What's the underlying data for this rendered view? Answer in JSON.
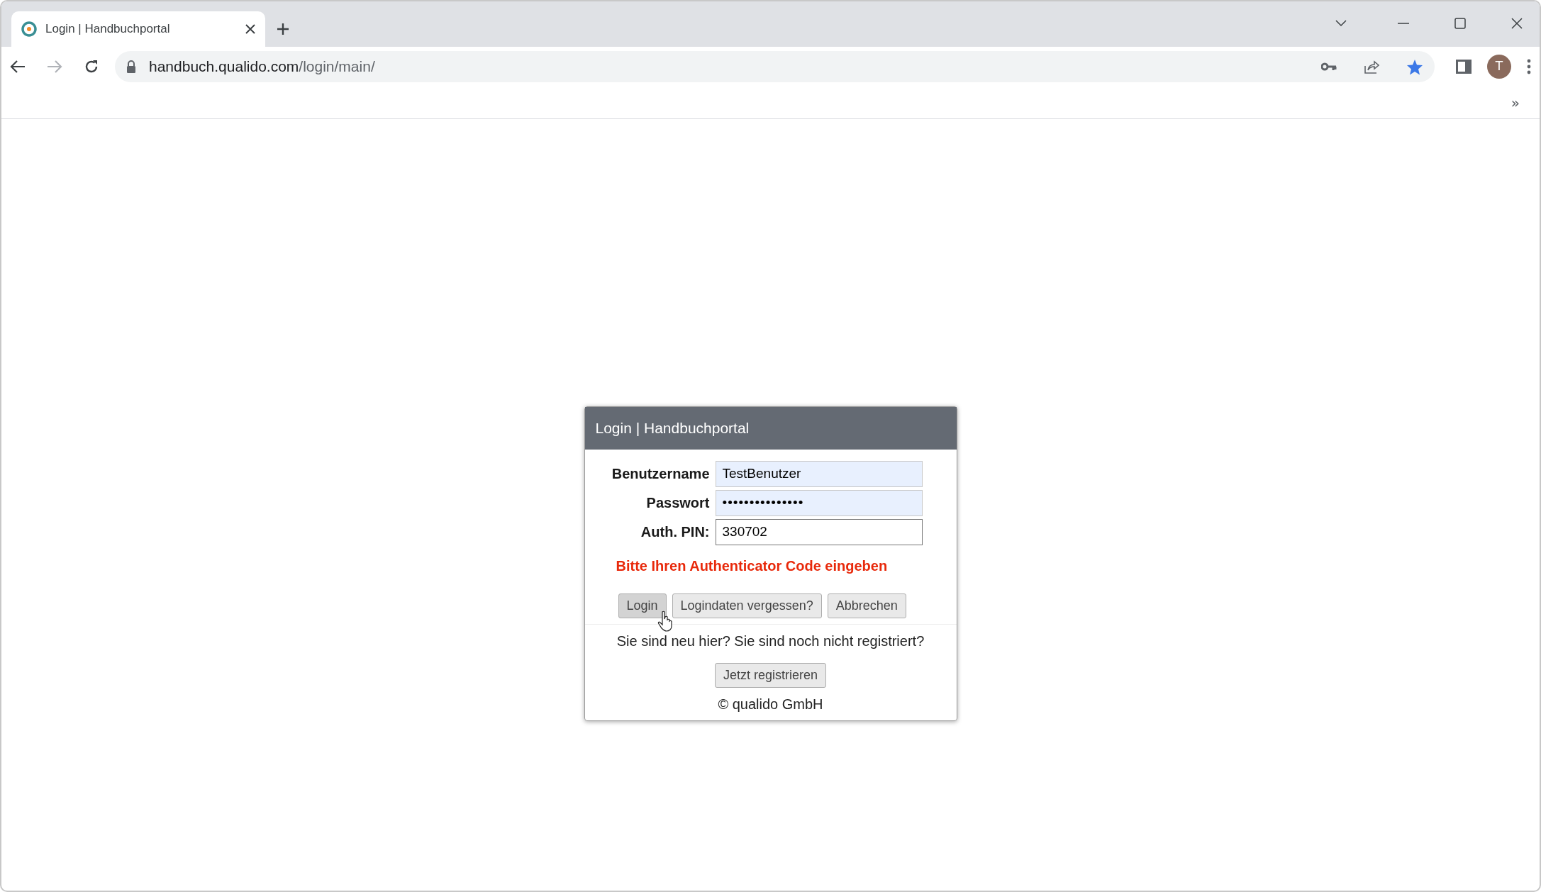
{
  "browser": {
    "tab": {
      "title": "Login | Handbuchportal",
      "selected": true
    },
    "address": {
      "host": "handbuch.qualido.com",
      "path": "/login/main/"
    },
    "profile_initial": "T",
    "bookmarked": true,
    "bookmarks_overflow": "»"
  },
  "dialog": {
    "title": "Login | Handbuchportal",
    "fields": [
      {
        "label": "Benutzername",
        "value": "TestBenutzer",
        "kind": "text",
        "autofilled": true
      },
      {
        "label": "Passwort",
        "value": "•••••••••••••••",
        "kind": "password",
        "autofilled": true
      },
      {
        "label": "Auth. PIN:",
        "value": "330702",
        "kind": "text",
        "autofilled": false
      }
    ],
    "error": "Bitte Ihren Authenticator Code eingeben",
    "buttons": [
      {
        "label": "Login",
        "hovered": true
      },
      {
        "label": "Logindaten vergessen?",
        "hovered": false
      },
      {
        "label": "Abbrechen",
        "hovered": false
      }
    ],
    "register_prompt": "Sie sind neu hier? Sie sind noch nicht registriert?",
    "register_button": "Jetzt registrieren",
    "footer": "© qualido GmbH"
  }
}
